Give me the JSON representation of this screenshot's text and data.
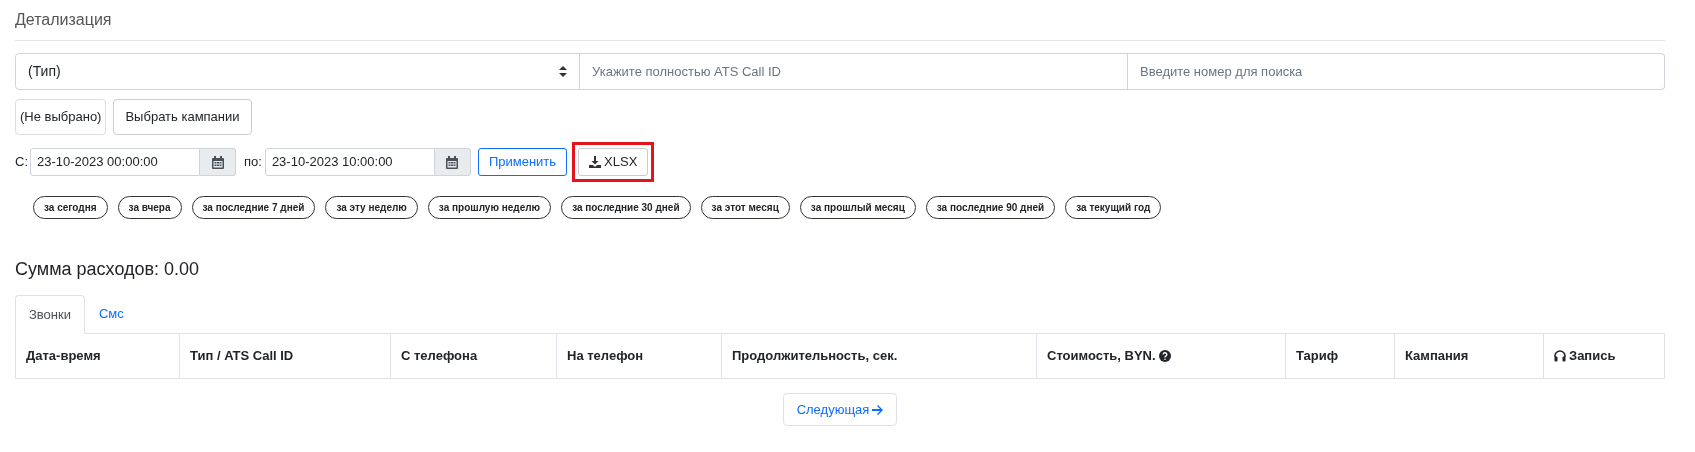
{
  "title": "Детализация",
  "filters": {
    "type_select": {
      "value": "(Тип)"
    },
    "call_id": {
      "placeholder": "Укажите полностью ATS Call ID"
    },
    "number": {
      "placeholder": "Введите номер для поиска"
    }
  },
  "campaign": {
    "selected_label": "(Не выбрано)",
    "button": "Выбрать кампании"
  },
  "date_range": {
    "from_label": "С:",
    "from": "23-10-2023 00:00:00",
    "to_label": "по:",
    "to": "23-10-2023 10:00:00",
    "apply": "Применить",
    "export": {
      "label": "XLSX",
      "highlighted": true
    }
  },
  "presets": [
    "за сегодня",
    "за вчера",
    "за последние 7 дней",
    "за эту неделю",
    "за прошлую неделю",
    "за последние 30 дней",
    "за этот месяц",
    "за прошлый месяц",
    "за последние 90 дней",
    "за текущий год"
  ],
  "total": "Сумма расходов: 0.00",
  "tabs": [
    {
      "label": "Звонки",
      "selected": true
    },
    {
      "label": "Смс",
      "selected": false
    }
  ],
  "table": {
    "columns": [
      {
        "label": "Дата-время",
        "kind": "plain"
      },
      {
        "label": "Тип / ATS Call ID",
        "kind": "plain"
      },
      {
        "label": "С телефона",
        "kind": "plain"
      },
      {
        "label": "На телефон",
        "kind": "plain"
      },
      {
        "label": "Продолжительность, сек.",
        "kind": "plain"
      },
      {
        "label": "Стоимость, BYN.",
        "kind": "help"
      },
      {
        "label": "Тариф",
        "kind": "plain"
      },
      {
        "label": "Кампания",
        "kind": "plain"
      },
      {
        "label": "Запись",
        "kind": "audio"
      }
    ]
  },
  "next_button": "Следующая"
}
